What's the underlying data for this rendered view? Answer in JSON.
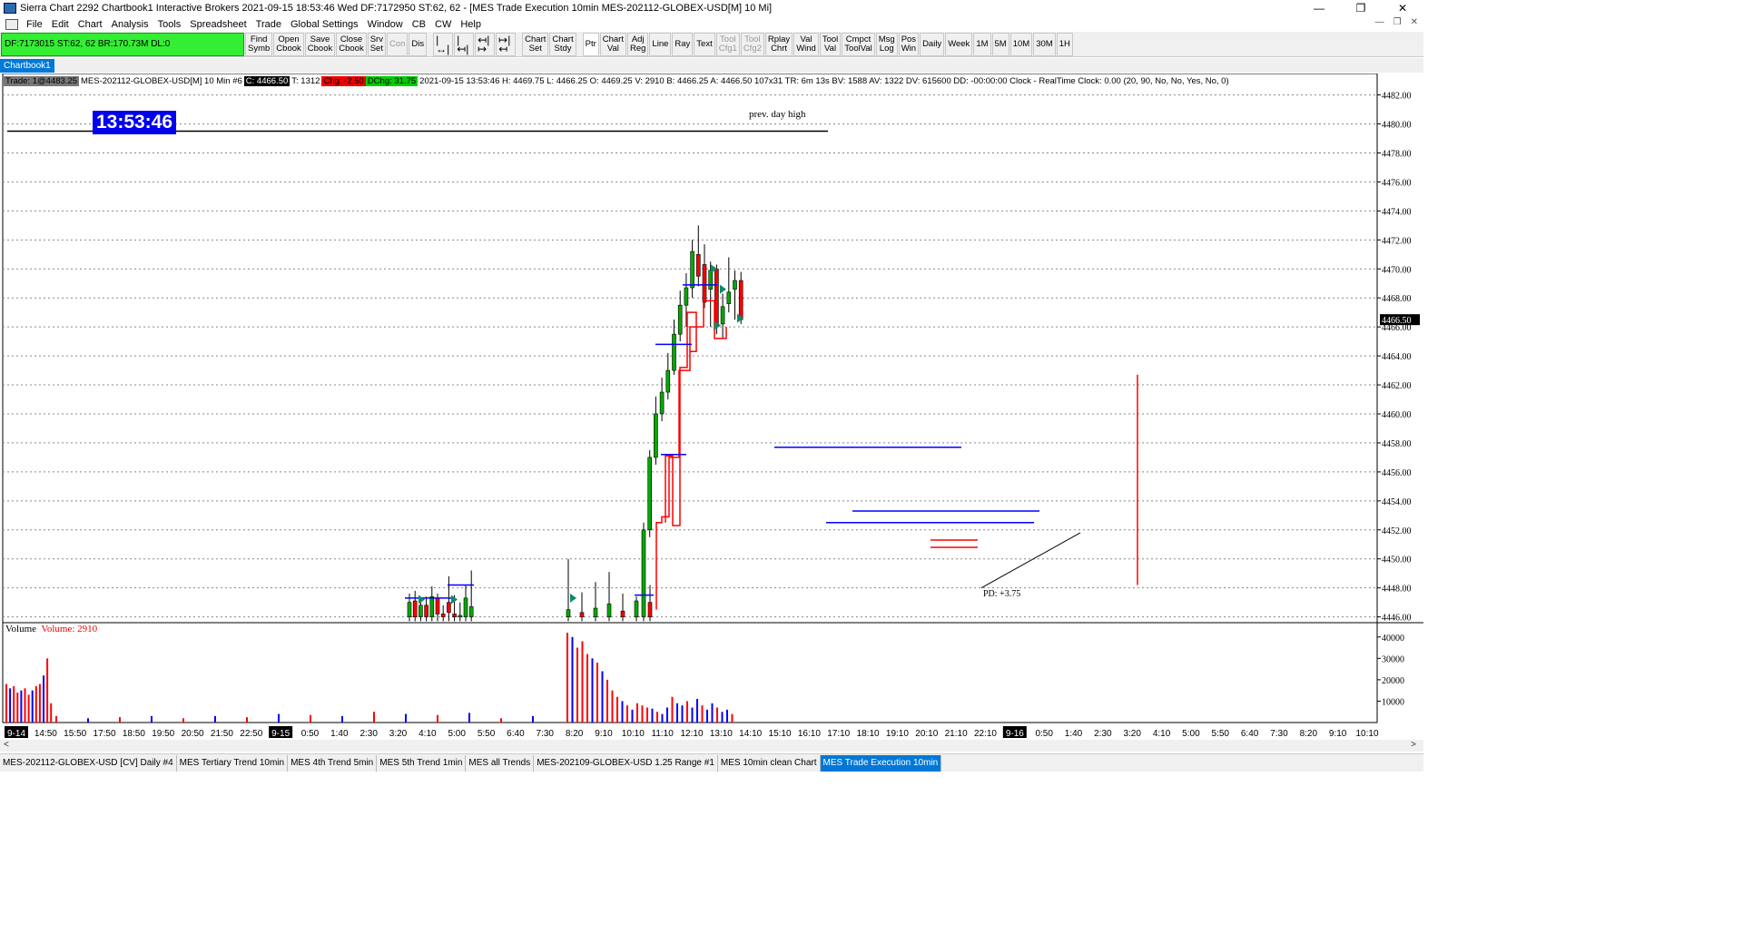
{
  "window": {
    "title": "Sierra Chart 2292 Chartbook1  Interactive Brokers 2021-09-15  18:53:46 Wed  DF:7172950  ST:62, 62 - [MES Trade Execution 10min MES-202112-GLOBEX-USD[M]  10 Mi]",
    "min": "—",
    "max": "❐",
    "close": "✕"
  },
  "menu": {
    "items": [
      "File",
      "Edit",
      "Chart",
      "Analysis",
      "Tools",
      "Spreadsheet",
      "Trade",
      "Global Settings",
      "Window",
      "CB",
      "CW",
      "Help"
    ]
  },
  "toolbar": {
    "status": "DF:7173015  ST:62, 62   BR:170.73M  DL:0",
    "buttons": [
      {
        "l1": "Find",
        "l2": "Symb"
      },
      {
        "l1": "Open",
        "l2": "Cbook"
      },
      {
        "l1": "Save",
        "l2": "Cbook"
      },
      {
        "l1": "Close",
        "l2": "Cbook"
      },
      {
        "l1": "Srv",
        "l2": "Set"
      },
      {
        "l1": "Con",
        "l2": "",
        "disabled": true
      },
      {
        "l1": "Dis",
        "l2": ""
      },
      {
        "l1": "|↔|",
        "l2": "",
        "glyph": true
      },
      {
        "l1": "|↤|",
        "l2": "",
        "glyph": true
      },
      {
        "l1": "↤|↦",
        "l2": "",
        "glyph": true
      },
      {
        "l1": "↦|↤",
        "l2": "",
        "glyph": true
      },
      {
        "l1": "Chart",
        "l2": "Set"
      },
      {
        "l1": "Chart",
        "l2": "Stdy"
      },
      {
        "l1": "Ptr",
        "l2": "",
        "active": true
      },
      {
        "l1": "Chart",
        "l2": "Val"
      },
      {
        "l1": "Adj",
        "l2": "Reg"
      },
      {
        "l1": "Line",
        "l2": ""
      },
      {
        "l1": "Ray",
        "l2": ""
      },
      {
        "l1": "Text",
        "l2": ""
      },
      {
        "l1": "Tool",
        "l2": "Cfg1",
        "disabled": true
      },
      {
        "l1": "Tool",
        "l2": "Cfg2",
        "disabled": true
      },
      {
        "l1": "Rplay",
        "l2": "Chrt"
      },
      {
        "l1": "Val",
        "l2": "Wind"
      },
      {
        "l1": "Tool",
        "l2": "Val"
      },
      {
        "l1": "Cmpct",
        "l2": "ToolVal"
      },
      {
        "l1": "Msg",
        "l2": "Log"
      },
      {
        "l1": "Pos",
        "l2": "Win"
      },
      {
        "l1": "Daily",
        "l2": ""
      },
      {
        "l1": "Week",
        "l2": ""
      },
      {
        "l1": "1M",
        "l2": ""
      },
      {
        "l1": "5M",
        "l2": ""
      },
      {
        "l1": "10M",
        "l2": ""
      },
      {
        "l1": "30M",
        "l2": ""
      },
      {
        "l1": "1H",
        "l2": ""
      }
    ]
  },
  "chartbook_tab": "Chartbook1",
  "infoline": {
    "trade": "Trade: 1@4483.25",
    "symbol": "MES-202112-GLOBEX-USD[M]  10 Min  #6",
    "close": "C: 4466.50",
    "trades": "T: 1312",
    "chg": "Chg: -2.50",
    "dchg": "DChg: 31.75",
    "rest": "2021-09-15 13:53:46 H: 4469.75 L: 4466.25 O: 4469.25 V: 2910 B: 4466.25 A: 4466.50 107x31 TR: 6m 13s BV: 1588 AV: 1322 DV: 615600 DD: -00:00:00 Clock - RealTime  Clock: 0.00   (20, 90, No, No, Yes, No, 0)"
  },
  "clock": "13:53:46",
  "prev_day_label": "prev. day high",
  "pd_label": "PD: +3.75",
  "last_price_label": "4466.50",
  "volume_label": {
    "name": "Volume",
    "value": "Volume: 2910"
  },
  "colors": {
    "up": "#00aa00",
    "down": "#ff0000",
    "blue": "#0000ff",
    "accent": "#0078d7"
  },
  "chart_data": {
    "type": "candlestick",
    "price_ticks": [
      "4482.00",
      "4480.00",
      "4478.00",
      "4476.00",
      "4474.00",
      "4472.00",
      "4470.00",
      "4468.00",
      "4466.00",
      "4464.00",
      "4462.00",
      "4460.00",
      "4458.00",
      "4456.00",
      "4454.00",
      "4452.00",
      "4450.00",
      "4448.00",
      "4446.00"
    ],
    "price_range": [
      4445.6,
      4482.6
    ],
    "volume_ticks": [
      "40000",
      "30000",
      "20000",
      "10000"
    ],
    "volume_range": [
      0,
      45000
    ],
    "time_labels": [
      "9-14",
      "14:50",
      "15:50",
      "17:50",
      "18:50",
      "19:50",
      "20:50",
      "21:50",
      "22:50",
      "9-15",
      "0:50",
      "1:40",
      "2:30",
      "3:20",
      "4:10",
      "5:00",
      "5:50",
      "6:40",
      "7:30",
      "8:20",
      "9:10",
      "10:10",
      "11:10",
      "12:10",
      "13:10",
      "14:10",
      "15:10",
      "16:10",
      "17:10",
      "18:10",
      "19:10",
      "20:10",
      "21:10",
      "22:10",
      "9-16",
      "0:50",
      "1:40",
      "2:30",
      "3:20",
      "4:10",
      "5:00",
      "5:50",
      "6:40",
      "7:30",
      "8:20",
      "9:10",
      "10:10"
    ],
    "date_markers": [
      "9-14",
      "9-15",
      "9-16"
    ],
    "prev_day_high": 4479.5,
    "candles": [
      {
        "o": 4446.0,
        "h": 4447.6,
        "l": 4445.7,
        "c": 4447.0
      },
      {
        "o": 4447.1,
        "h": 4447.8,
        "l": 4445.7,
        "c": 4446.0
      },
      {
        "o": 4446.0,
        "h": 4447.0,
        "l": 4445.7,
        "c": 4446.8
      },
      {
        "o": 4446.8,
        "h": 4447.4,
        "l": 4445.7,
        "c": 4446.0
      },
      {
        "o": 4446.0,
        "h": 4448.1,
        "l": 4445.7,
        "c": 4447.4
      },
      {
        "o": 4447.3,
        "h": 4447.6,
        "l": 4445.7,
        "c": 4446.2
      },
      {
        "o": 4446.2,
        "h": 4446.8,
        "l": 4445.7,
        "c": 4446.0
      },
      {
        "o": 4447.0,
        "h": 4448.8,
        "l": 4445.7,
        "c": 4446.3
      },
      {
        "o": 4446.2,
        "h": 4447.5,
        "l": 4445.7,
        "c": 4446.0
      },
      {
        "o": 4446.0,
        "h": 4447.0,
        "l": 4445.7,
        "c": 4446.1
      },
      {
        "o": 4446.0,
        "h": 4448.2,
        "l": 4445.7,
        "c": 4447.3
      },
      {
        "o": 4446.0,
        "h": 4449.2,
        "l": 4445.7,
        "c": 4446.7
      },
      {
        "o": 4446.0,
        "h": 4450.0,
        "l": 4445.7,
        "c": 4446.5
      },
      {
        "o": 4446.3,
        "h": 4447.7,
        "l": 4445.7,
        "c": 4446.0
      },
      {
        "o": 4446.0,
        "h": 4448.4,
        "l": 4445.7,
        "c": 4446.6
      },
      {
        "o": 4446.0,
        "h": 4449.1,
        "l": 4445.7,
        "c": 4446.9
      },
      {
        "o": 4446.4,
        "h": 4447.6,
        "l": 4445.7,
        "c": 4446.0
      },
      {
        "o": 4446.0,
        "h": 4447.4,
        "l": 4445.7,
        "c": 4447.1
      },
      {
        "o": 4447.0,
        "h": 4448.2,
        "l": 4445.7,
        "c": 4446.0
      },
      {
        "o": 4446.0,
        "h": 4452.5,
        "l": 4445.7,
        "c": 4452.0
      },
      {
        "o": 4452.0,
        "h": 4457.5,
        "l": 4451.5,
        "c": 4457.0
      },
      {
        "o": 4457.0,
        "h": 4461.2,
        "l": 4456.5,
        "c": 4460.0
      },
      {
        "o": 4460.0,
        "h": 4462.5,
        "l": 4459.5,
        "c": 4461.5
      },
      {
        "o": 4461.5,
        "h": 4464.2,
        "l": 4461.0,
        "c": 4463.0
      },
      {
        "o": 4463.0,
        "h": 4466.5,
        "l": 4462.7,
        "c": 4465.5
      },
      {
        "o": 4465.5,
        "h": 4468.5,
        "l": 4465.0,
        "c": 4467.5
      },
      {
        "o": 4467.5,
        "h": 4469.7,
        "l": 4466.0,
        "c": 4468.7
      },
      {
        "o": 4468.7,
        "h": 4472.0,
        "l": 4468.0,
        "c": 4471.2
      },
      {
        "o": 4471.0,
        "h": 4473.0,
        "l": 4468.8,
        "c": 4469.5
      },
      {
        "o": 4470.3,
        "h": 4471.7,
        "l": 4467.3,
        "c": 4467.7
      },
      {
        "o": 4468.6,
        "h": 4470.5,
        "l": 4466.0,
        "c": 4469.9
      },
      {
        "o": 4470.0,
        "h": 4470.3,
        "l": 4465.5,
        "c": 4466.0
      },
      {
        "o": 4466.2,
        "h": 4468.3,
        "l": 4465.2,
        "c": 4467.4
      },
      {
        "o": 4467.6,
        "h": 4470.8,
        "l": 4467.0,
        "c": 4468.4
      },
      {
        "o": 4468.6,
        "h": 4469.9,
        "l": 4466.5,
        "c": 4469.2
      },
      {
        "o": 4469.2,
        "h": 4469.8,
        "l": 4466.2,
        "c": 4466.5
      }
    ],
    "volumes_left": [
      18000,
      16000,
      17000,
      14000,
      15000,
      16000,
      13000,
      15000,
      17000,
      18000,
      22000,
      30000,
      9000
    ],
    "volumes_mid": [
      3000,
      2000,
      2500,
      3000,
      2000,
      3000,
      2500,
      4000,
      3500,
      3000,
      5000,
      4000,
      3500,
      4500,
      2000,
      3000
    ],
    "volumes_main": [
      42000,
      40000,
      35000,
      38000,
      32000,
      30000,
      28000,
      24000,
      20000,
      15000,
      12000,
      10000,
      8000,
      6000,
      9000,
      8000,
      7000,
      6500,
      5000,
      4000,
      7000,
      12000,
      9000,
      8000,
      10000,
      7000,
      11000,
      8000,
      6000,
      9000,
      7000,
      5000,
      6000,
      4000
    ]
  },
  "bottom_tabs": [
    "MES-202112-GLOBEX-USD [CV]  Daily  #4",
    "MES Tertiary Trend 10min",
    "MES 4th Trend 5min",
    "MES 5th Trend 1min",
    "MES all Trends",
    "MES-202109-GLOBEX-USD  1.25 Range  #1",
    "MES 10min clean Chart",
    "MES Trade Execution 10min"
  ]
}
